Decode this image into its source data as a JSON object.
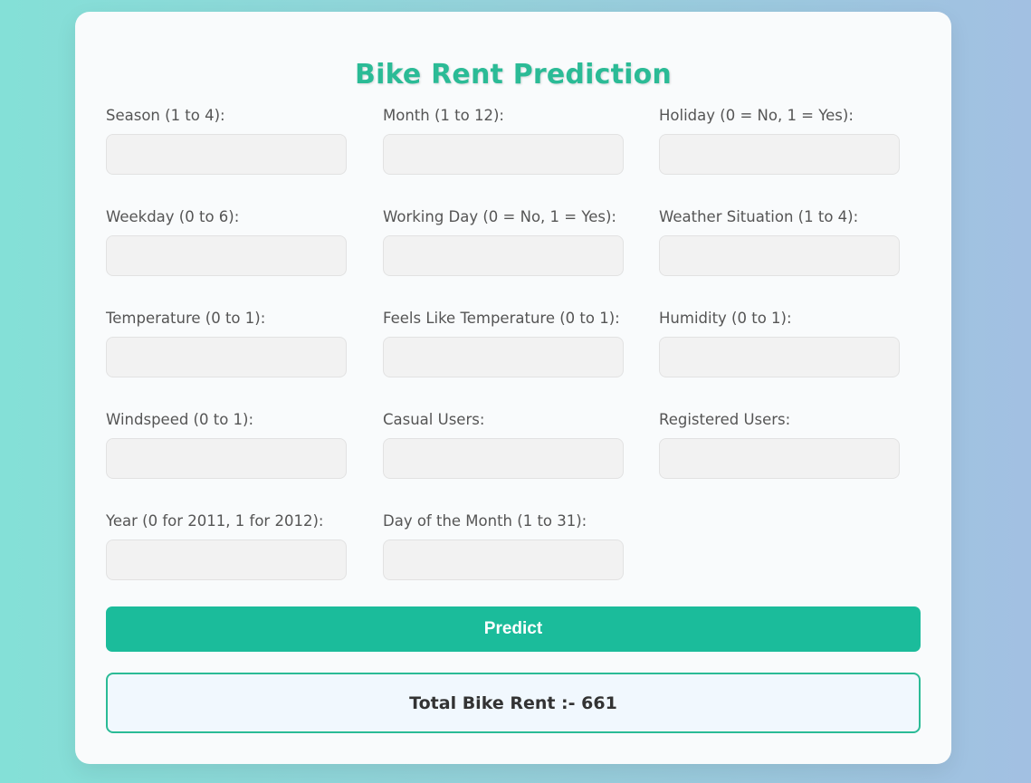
{
  "page": {
    "title": "Bike Rent Prediction"
  },
  "form": {
    "fields": [
      {
        "label": "Season (1 to 4):",
        "value": "",
        "placeholder": ""
      },
      {
        "label": "Month (1 to 12):",
        "value": "",
        "placeholder": ""
      },
      {
        "label": "Holiday (0 = No, 1 = Yes):",
        "value": "",
        "placeholder": ""
      },
      {
        "label": "Weekday (0 to 6):",
        "value": "",
        "placeholder": ""
      },
      {
        "label": "Working Day (0 = No, 1 = Yes):",
        "value": "",
        "placeholder": ""
      },
      {
        "label": "Weather Situation (1 to 4):",
        "value": "",
        "placeholder": ""
      },
      {
        "label": "Temperature (0 to 1):",
        "value": "",
        "placeholder": ""
      },
      {
        "label": "Feels Like Temperature (0 to 1):",
        "value": "",
        "placeholder": ""
      },
      {
        "label": "Humidity (0 to 1):",
        "value": "",
        "placeholder": ""
      },
      {
        "label": "Windspeed (0 to 1):",
        "value": "",
        "placeholder": ""
      },
      {
        "label": "Casual Users:",
        "value": "",
        "placeholder": ""
      },
      {
        "label": "Registered Users:",
        "value": "",
        "placeholder": ""
      },
      {
        "label": "Year (0 for 2011, 1 for 2012):",
        "value": "",
        "placeholder": ""
      },
      {
        "label": "Day of the Month (1 to 31):",
        "value": "",
        "placeholder": ""
      }
    ],
    "predict_label": "Predict"
  },
  "result": {
    "text": "Total Bike Rent :- 661"
  },
  "colors": {
    "accent": "#1bbc9b",
    "title": "#2bbb96",
    "result_bg": "#f1f8fe"
  }
}
